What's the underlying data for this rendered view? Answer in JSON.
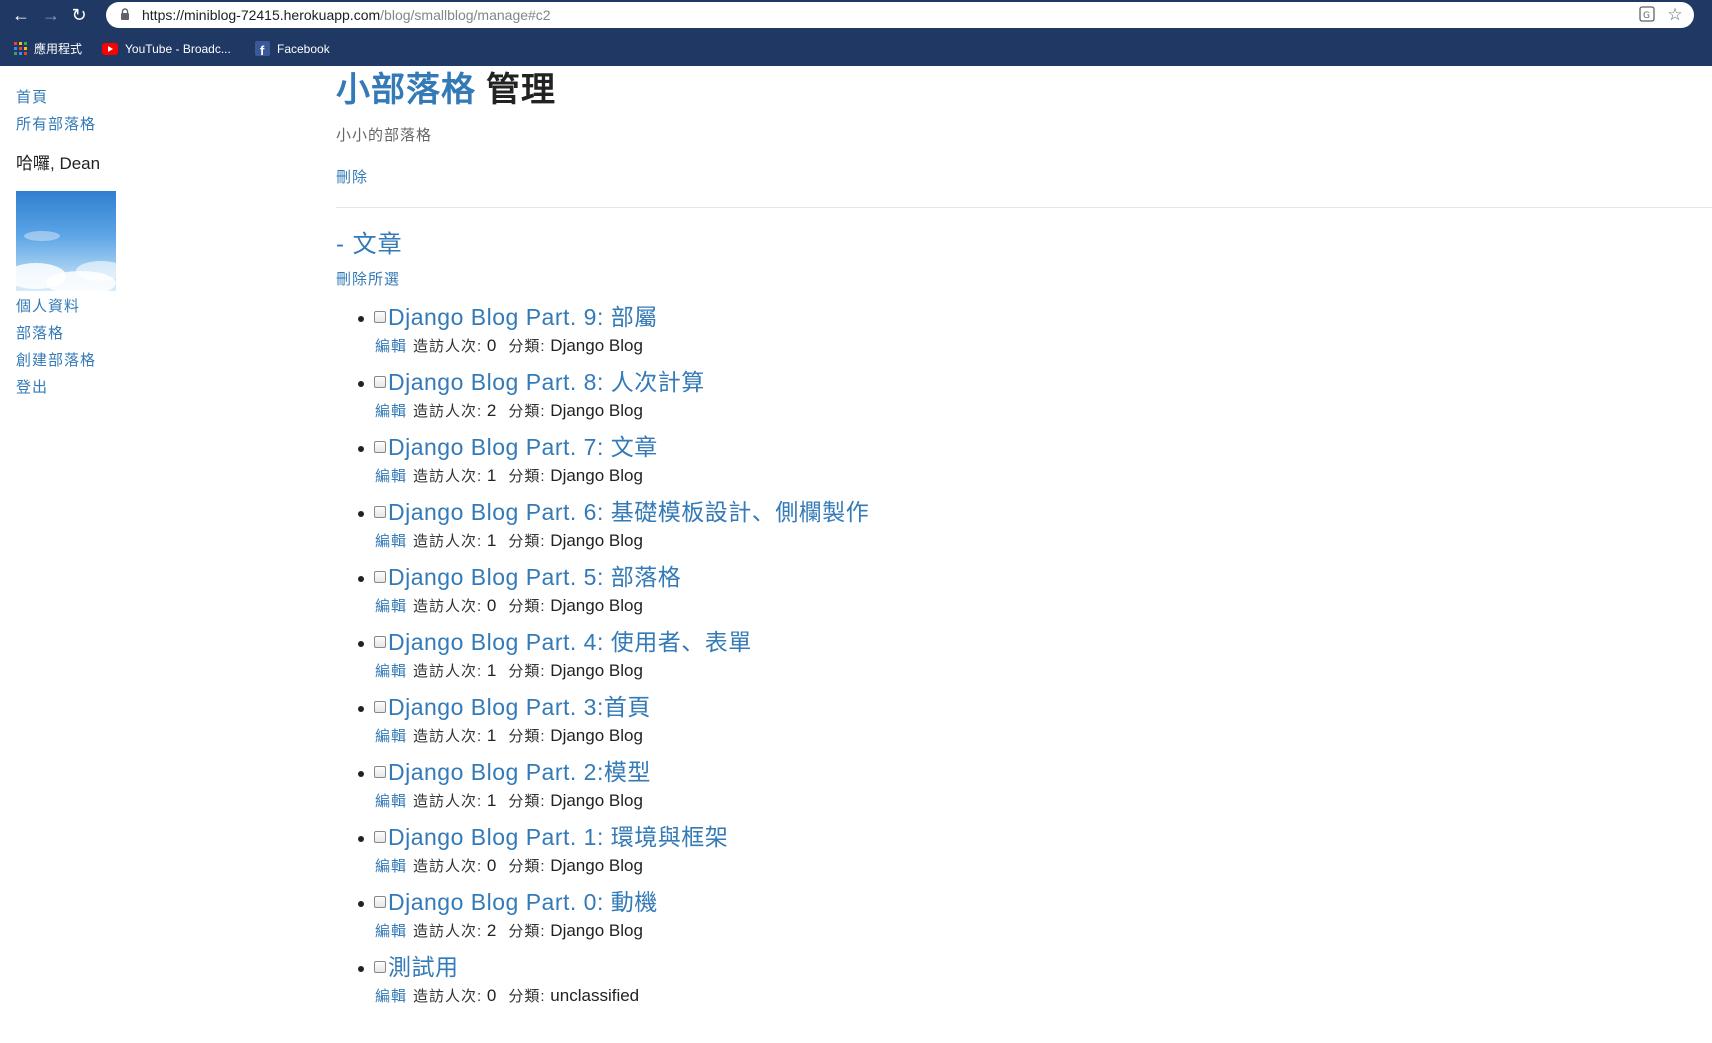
{
  "browser": {
    "url_host": "https://miniblog-72415.herokuapp.com",
    "url_path": "/blog/smallblog/manage#c2",
    "bookmarks": [
      {
        "label": "應用程式",
        "icon": "apps-grid-icon"
      },
      {
        "label": "YouTube - Broadc...",
        "icon": "youtube-icon"
      },
      {
        "label": "Facebook",
        "icon": "facebook-icon"
      }
    ]
  },
  "sidebar": {
    "nav": [
      {
        "label": "首頁"
      },
      {
        "label": "所有部落格"
      }
    ],
    "greeting": "哈囉, Dean",
    "user_links": [
      {
        "label": "個人資料"
      },
      {
        "label": "部落格"
      },
      {
        "label": "創建部落格"
      },
      {
        "label": "登出"
      }
    ]
  },
  "blog": {
    "name": "小部落格",
    "manage_label": "管理",
    "subtitle": "小小的部落格",
    "delete_label": "刪除",
    "section_title": "- 文章",
    "delete_selected_label": "刪除所選"
  },
  "labels": {
    "edit": "編輯",
    "views": "造訪人次:",
    "category": "分類:"
  },
  "posts": [
    {
      "title": "Django Blog Part. 9: 部屬",
      "views": "0",
      "category": "Django Blog"
    },
    {
      "title": "Django Blog Part. 8: 人次計算",
      "views": "2",
      "category": "Django Blog"
    },
    {
      "title": "Django Blog Part. 7: 文章",
      "views": "1",
      "category": "Django Blog"
    },
    {
      "title": "Django Blog Part. 6: 基礎模板設計、側欄製作",
      "views": "1",
      "category": "Django Blog"
    },
    {
      "title": "Django Blog Part. 5: 部落格",
      "views": "0",
      "category": "Django Blog"
    },
    {
      "title": "Django Blog Part. 4: 使用者、表單",
      "views": "1",
      "category": "Django Blog"
    },
    {
      "title": "Django Blog Part. 3:首頁",
      "views": "1",
      "category": "Django Blog"
    },
    {
      "title": "Django Blog Part. 2:模型",
      "views": "1",
      "category": "Django Blog"
    },
    {
      "title": "Django Blog Part. 1: 環境與框架",
      "views": "0",
      "category": "Django Blog"
    },
    {
      "title": "Django Blog Part. 0: 動機",
      "views": "2",
      "category": "Django Blog"
    },
    {
      "title": "測試用",
      "views": "0",
      "category": "unclassified"
    }
  ]
}
